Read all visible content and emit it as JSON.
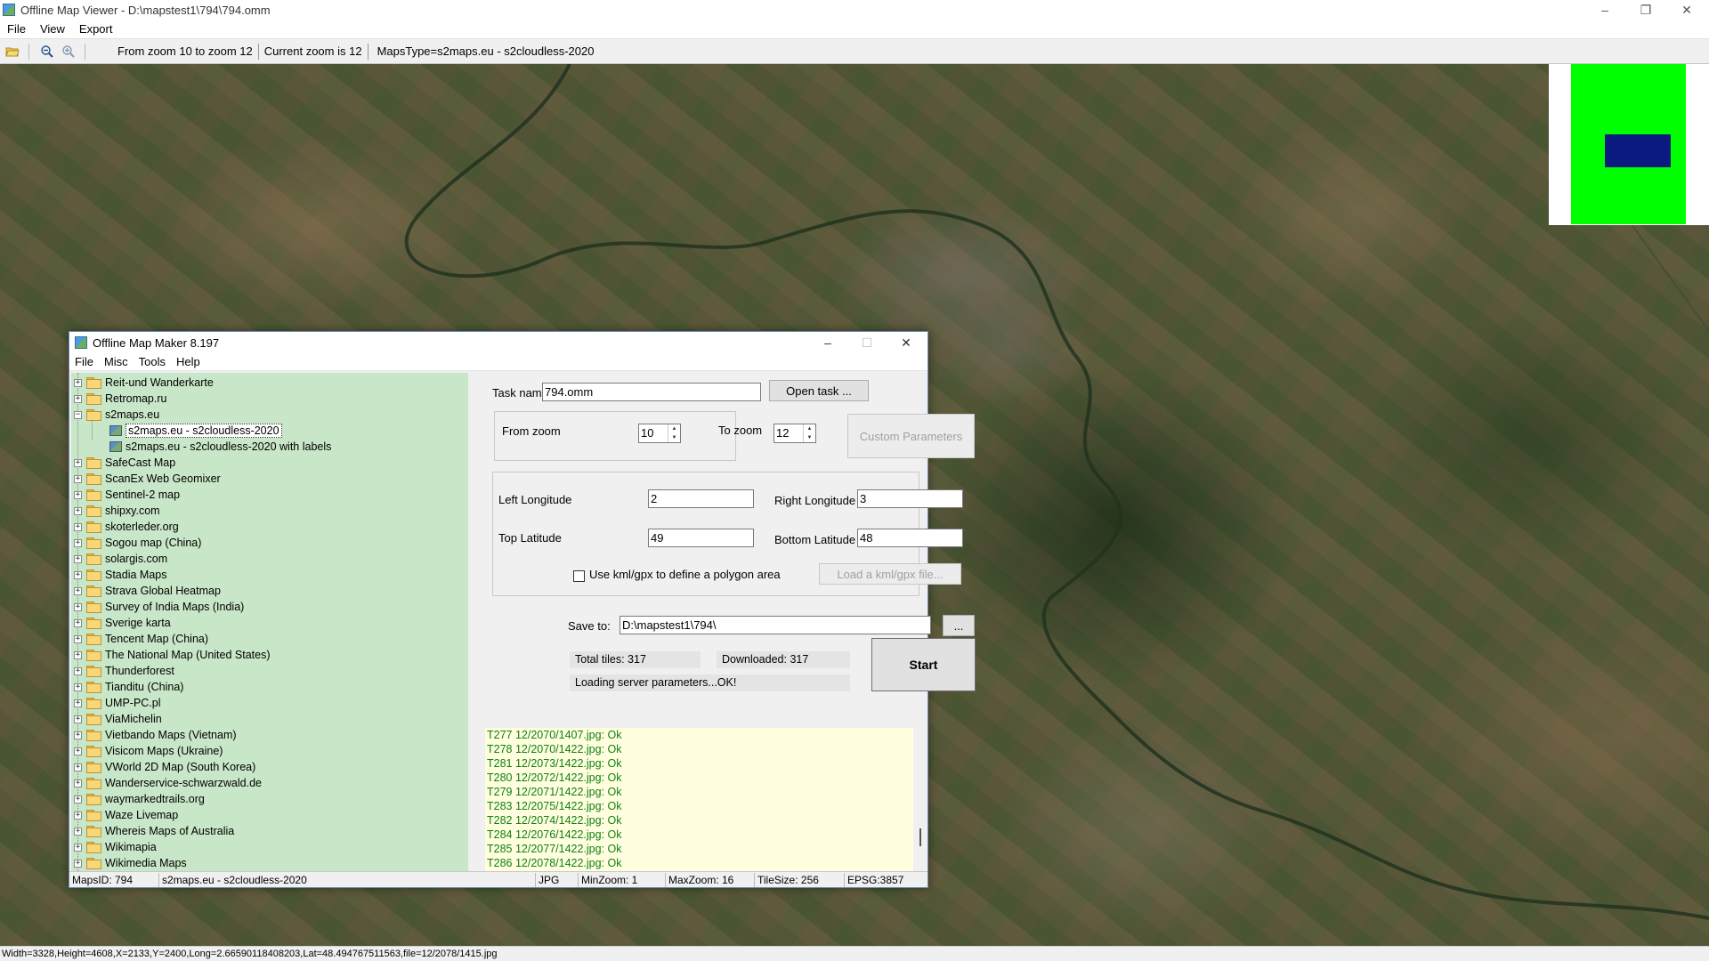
{
  "viewer": {
    "title": "Offline Map Viewer - D:\\mapstest1\\794\\794.omm",
    "menu": [
      "File",
      "View",
      "Export"
    ],
    "toolbar": {
      "zoom_range": "From zoom 10 to zoom 12",
      "current_zoom": "Current zoom is 12",
      "maps_type": "MapsType=s2maps.eu - s2cloudless-2020"
    },
    "window_controls": {
      "minimize": "–",
      "restore": "❐",
      "close": "✕"
    },
    "minimap": {
      "background": "#00ff00",
      "viewport": "#0b1a80"
    },
    "status": "Width=3328,Height=4608,X=2133,Y=2400,Long=2.66590118408203,Lat=48.494767511563,file=12/2078/1415.jpg"
  },
  "maker": {
    "title": "Offline Map Maker 8.197",
    "menu": [
      "File",
      "Misc",
      "Tools",
      "Help"
    ],
    "window_controls": {
      "minimize": "–",
      "maximize": "☐",
      "close": "✕"
    },
    "tree": [
      {
        "label": "Reit-und Wanderkarte",
        "type": "folder",
        "expander": "+"
      },
      {
        "label": "Retromap.ru",
        "type": "folder",
        "expander": "+"
      },
      {
        "label": "s2maps.eu",
        "type": "folder-open",
        "expander": "−"
      },
      {
        "label": "s2maps.eu - s2cloudless-2020",
        "type": "map",
        "selected": true
      },
      {
        "label": "s2maps.eu - s2cloudless-2020 with labels",
        "type": "map"
      },
      {
        "label": "SafeCast Map",
        "type": "folder",
        "expander": "+"
      },
      {
        "label": "ScanEx Web Geomixer",
        "type": "folder",
        "expander": "+"
      },
      {
        "label": "Sentinel-2 map",
        "type": "folder",
        "expander": "+"
      },
      {
        "label": "shipxy.com",
        "type": "folder",
        "expander": "+"
      },
      {
        "label": "skoterleder.org",
        "type": "folder",
        "expander": "+"
      },
      {
        "label": "Sogou map (China)",
        "type": "folder",
        "expander": "+"
      },
      {
        "label": "solargis.com",
        "type": "folder",
        "expander": "+"
      },
      {
        "label": "Stadia Maps",
        "type": "folder",
        "expander": "+"
      },
      {
        "label": "Strava Global Heatmap",
        "type": "folder",
        "expander": "+"
      },
      {
        "label": "Survey of India Maps (India)",
        "type": "folder",
        "expander": "+"
      },
      {
        "label": "Sverige karta",
        "type": "folder",
        "expander": "+"
      },
      {
        "label": "Tencent Map (China)",
        "type": "folder",
        "expander": "+"
      },
      {
        "label": "The National Map (United States)",
        "type": "folder",
        "expander": "+"
      },
      {
        "label": "Thunderforest",
        "type": "folder",
        "expander": "+"
      },
      {
        "label": "Tianditu (China)",
        "type": "folder",
        "expander": "+"
      },
      {
        "label": "UMP-PC.pl",
        "type": "folder",
        "expander": "+"
      },
      {
        "label": "ViaMichelin",
        "type": "folder",
        "expander": "+"
      },
      {
        "label": "Vietbando Maps (Vietnam)",
        "type": "folder",
        "expander": "+"
      },
      {
        "label": "Visicom Maps (Ukraine)",
        "type": "folder",
        "expander": "+"
      },
      {
        "label": "VWorld 2D Map (South Korea)",
        "type": "folder",
        "expander": "+"
      },
      {
        "label": "Wanderservice-schwarzwald.de",
        "type": "folder",
        "expander": "+"
      },
      {
        "label": "waymarkedtrails.org",
        "type": "folder",
        "expander": "+"
      },
      {
        "label": "Waze Livemap",
        "type": "folder",
        "expander": "+"
      },
      {
        "label": "Whereis Maps of Australia",
        "type": "folder",
        "expander": "+"
      },
      {
        "label": "Wikimapia",
        "type": "folder",
        "expander": "+"
      },
      {
        "label": "Wikimedia Maps",
        "type": "folder",
        "expander": "+"
      }
    ],
    "form": {
      "task_name_label": "Task name",
      "task_name_value": "794.omm",
      "open_task_label": "Open task ...",
      "from_zoom_label": "From zoom",
      "from_zoom_value": "10",
      "to_zoom_label": "To zoom",
      "to_zoom_value": "12",
      "custom_params_label": "Custom Parameters",
      "left_lon_label": "Left Longitude",
      "left_lon_value": "2",
      "right_lon_label": "Right Longitude",
      "right_lon_value": "3",
      "top_lat_label": "Top Latitude",
      "top_lat_value": "49",
      "bottom_lat_label": "Bottom Latitude",
      "bottom_lat_value": "48",
      "kml_checkbox_label": "Use kml/gpx to define a polygon area",
      "load_kml_label": "Load a kml/gpx file...",
      "save_to_label": "Save to:",
      "save_to_value": "D:\\mapstest1\\794\\",
      "browse_label": "...",
      "total_tiles": "Total tiles: 317",
      "downloaded": "Downloaded: 317",
      "server_status": "Loading server parameters...OK!",
      "start_label": "Start"
    },
    "log": [
      "T277 12/2070/1407.jpg: Ok",
      "T278 12/2070/1422.jpg: Ok",
      "T281 12/2073/1422.jpg: Ok",
      "T280 12/2072/1422.jpg: Ok",
      "T279 12/2071/1422.jpg: Ok",
      "T283 12/2075/1422.jpg: Ok",
      "T282 12/2074/1422.jpg: Ok",
      "T284 12/2076/1422.jpg: Ok",
      "T285 12/2077/1422.jpg: Ok",
      "T286 12/2078/1422.jpg: Ok"
    ],
    "status": {
      "maps_id": "MapsID: 794",
      "map_name": "s2maps.eu - s2cloudless-2020",
      "format": "JPG",
      "min_zoom": "MinZoom: 1",
      "max_zoom": "MaxZoom: 16",
      "tile_size": "TileSize: 256",
      "epsg": "EPSG:3857"
    }
  }
}
